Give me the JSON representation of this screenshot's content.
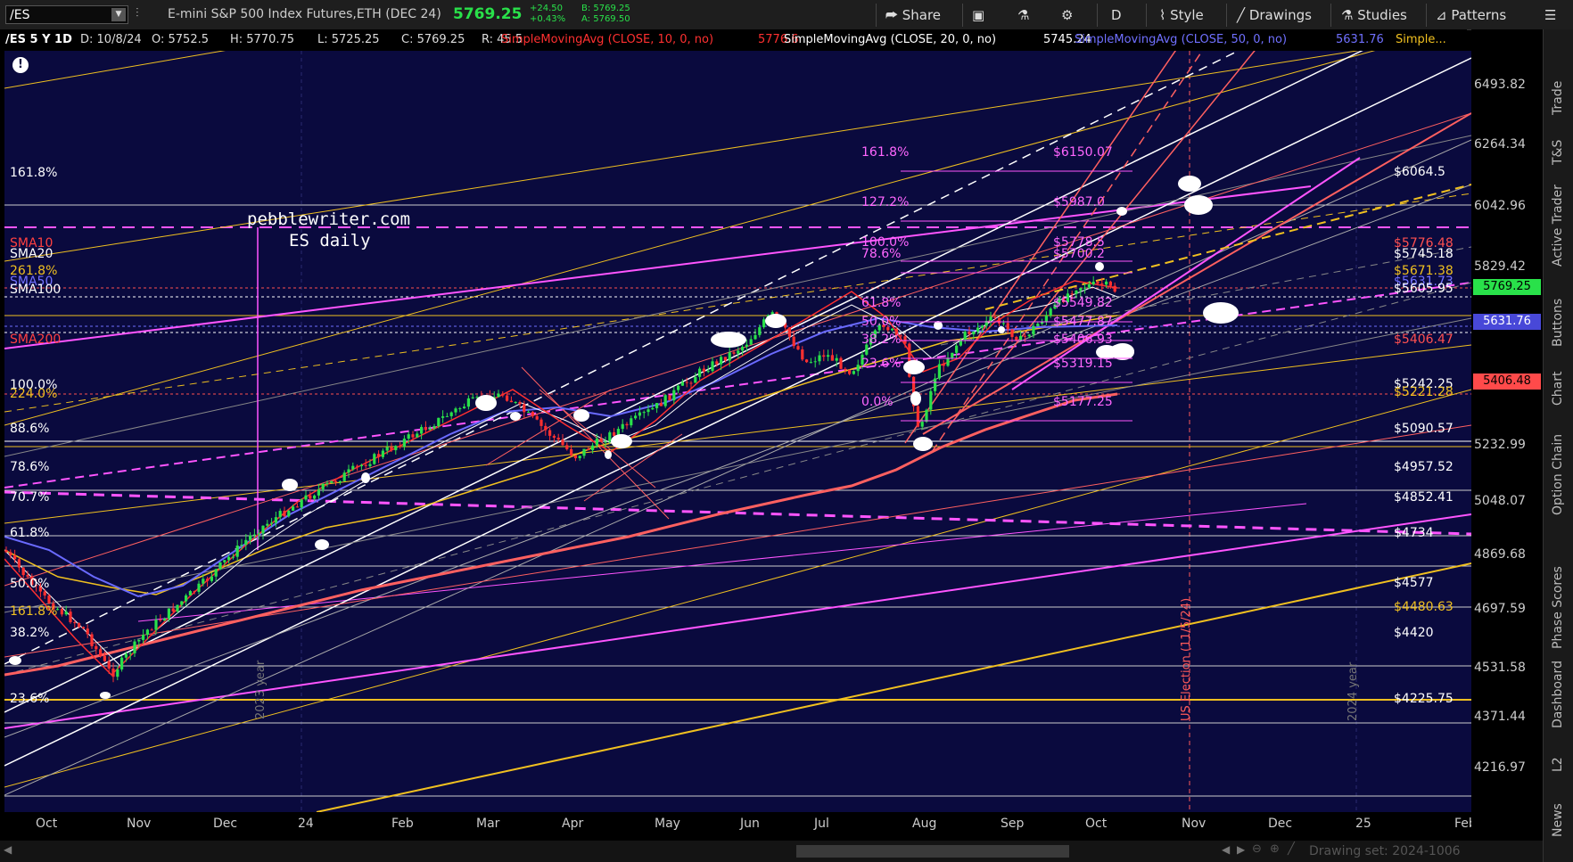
{
  "toolbar": {
    "symbol": "/ES",
    "description": "E-mini S&P 500 Index Futures,ETH (DEC 24)",
    "last_price": "5769.25",
    "net_change": "+24.50",
    "pct_change": "+0.43%",
    "bid": "B: 5769.25",
    "ask": "A: 5769.50",
    "share_label": "Share",
    "aggregation_label": "D",
    "style_label": "Style",
    "drawings_label": "Drawings",
    "studies_label": "Studies",
    "patterns_label": "Patterns"
  },
  "header": {
    "timeframe": "/ES 5 Y 1D",
    "date": "D: 10/8/24",
    "open": "O: 5752.5",
    "high": "H: 5770.75",
    "low": "L: 5725.25",
    "close": "C: 5769.25",
    "range": "R: 45.5",
    "sma10_label": "SimpleMovingAvg (CLOSE, 10, 0, no)",
    "sma10_value": "5776.6",
    "sma20_label": "SimpleMovingAvg (CLOSE, 20, 0, no)",
    "sma20_value": "5745.24",
    "sma50_label": "SimpleMovingAvg (CLOSE, 50, 0, no)",
    "sma50_value": "5631.76",
    "more": "Simple..."
  },
  "watermark": {
    "line1": "pebblewriter.com",
    "line2": "ES daily"
  },
  "colors": {
    "plot_bg": "#0a0a3e",
    "up": "#29e14a",
    "down": "#ff3030",
    "magenta": "#ff44ff",
    "gold": "#f0c020",
    "salmon": "#ff6060",
    "sma50": "#6a6aff"
  },
  "price_axis": {
    "ticks": [
      "6493.82",
      "6264.34",
      "6042.96",
      "5829.42",
      "5232.99",
      "5048.07",
      "4869.68",
      "4697.59",
      "4531.58",
      "4371.44",
      "4216.97"
    ],
    "last_badge": "5769.25",
    "sma50_badge": "5631.76",
    "sma200_badge": "5406.48"
  },
  "time_axis": [
    "Oct",
    "Nov",
    "Dec",
    "24",
    "Feb",
    "Mar",
    "Apr",
    "May",
    "Jun",
    "Jul",
    "Aug",
    "Sep",
    "Oct",
    "Nov",
    "Dec",
    "25",
    "Feb"
  ],
  "vertical_labels": {
    "year2023": "2023 year",
    "election": "US Election (11/5/24)",
    "year2024": "2024 year"
  },
  "left_fib": [
    {
      "label": "161.8%",
      "color": "#ffffff"
    },
    {
      "label": "SMA10",
      "color": "#ff4040"
    },
    {
      "label": "SMA20",
      "color": "#ffffff"
    },
    {
      "label": "261.8%",
      "color": "#f0c020"
    },
    {
      "label": "SMA50",
      "color": "#7070ff"
    },
    {
      "label": "SMA100",
      "color": "#ffffff"
    },
    {
      "label": "SMA200",
      "color": "#ff4040"
    },
    {
      "label": "100.0%",
      "color": "#ffffff"
    },
    {
      "label": "224.0%",
      "color": "#f0c020"
    },
    {
      "label": "88.6%",
      "color": "#ffffff"
    },
    {
      "label": "78.6%",
      "color": "#ffffff"
    },
    {
      "label": "70.7%",
      "color": "#ffffff"
    },
    {
      "label": "61.8%",
      "color": "#ffffff"
    },
    {
      "label": "50.0%",
      "color": "#ffffff"
    },
    {
      "label": "161.8%",
      "color": "#f0c020"
    },
    {
      "label": "38.2%",
      "color": "#ffffff"
    },
    {
      "label": "23.6%",
      "color": "#ffffff"
    }
  ],
  "mid_fib": [
    {
      "pct": "161.8%",
      "price": "$6150.07"
    },
    {
      "pct": "127.2%",
      "price": "$5987.0"
    },
    {
      "pct": "100.0%",
      "price": "$5778.5"
    },
    {
      "pct": "78.6%",
      "price": "$5700.2"
    },
    {
      "pct": "61.8%",
      "price": "$5549.82"
    },
    {
      "pct": "50.0%",
      "price": "$5477.87"
    },
    {
      "pct": "38.2%",
      "price": "$5406.93"
    },
    {
      "pct": "23.6%",
      "price": "$5319.15"
    },
    {
      "pct": "0.0%",
      "price": "$5177.25"
    }
  ],
  "right_levels": [
    {
      "label": "$6064.5",
      "color": "#ffffff"
    },
    {
      "label": "$5776.48",
      "color": "#ff5050"
    },
    {
      "label": "$5745.18",
      "color": "#ffffff"
    },
    {
      "label": "$5671.38",
      "color": "#f0c020"
    },
    {
      "label": "$5631.73",
      "color": "#7070ff"
    },
    {
      "label": "$5605.95",
      "color": "#ffffff"
    },
    {
      "label": "$5406.47",
      "color": "#ff5050"
    },
    {
      "label": "$5242.25",
      "color": "#ffffff"
    },
    {
      "label": "$5221.28",
      "color": "#f0c020"
    },
    {
      "label": "$5090.57",
      "color": "#ffffff"
    },
    {
      "label": "$4957.52",
      "color": "#ffffff"
    },
    {
      "label": "$4852.41",
      "color": "#ffffff"
    },
    {
      "label": "$4734",
      "color": "#ffffff"
    },
    {
      "label": "$4577",
      "color": "#ffffff"
    },
    {
      "label": "$4480.63",
      "color": "#f0c020"
    },
    {
      "label": "$4420",
      "color": "#ffffff"
    },
    {
      "label": "$4225.75",
      "color": "#ffffff"
    }
  ],
  "sidebar_tabs": [
    "Trade",
    "T&S",
    "Active Trader",
    "Buttons",
    "Chart",
    "Option Chain",
    "Phase Scores",
    "Dashboard",
    "L2",
    "News"
  ],
  "footer": {
    "drawing_set": "Drawing set: 2024-1006"
  }
}
